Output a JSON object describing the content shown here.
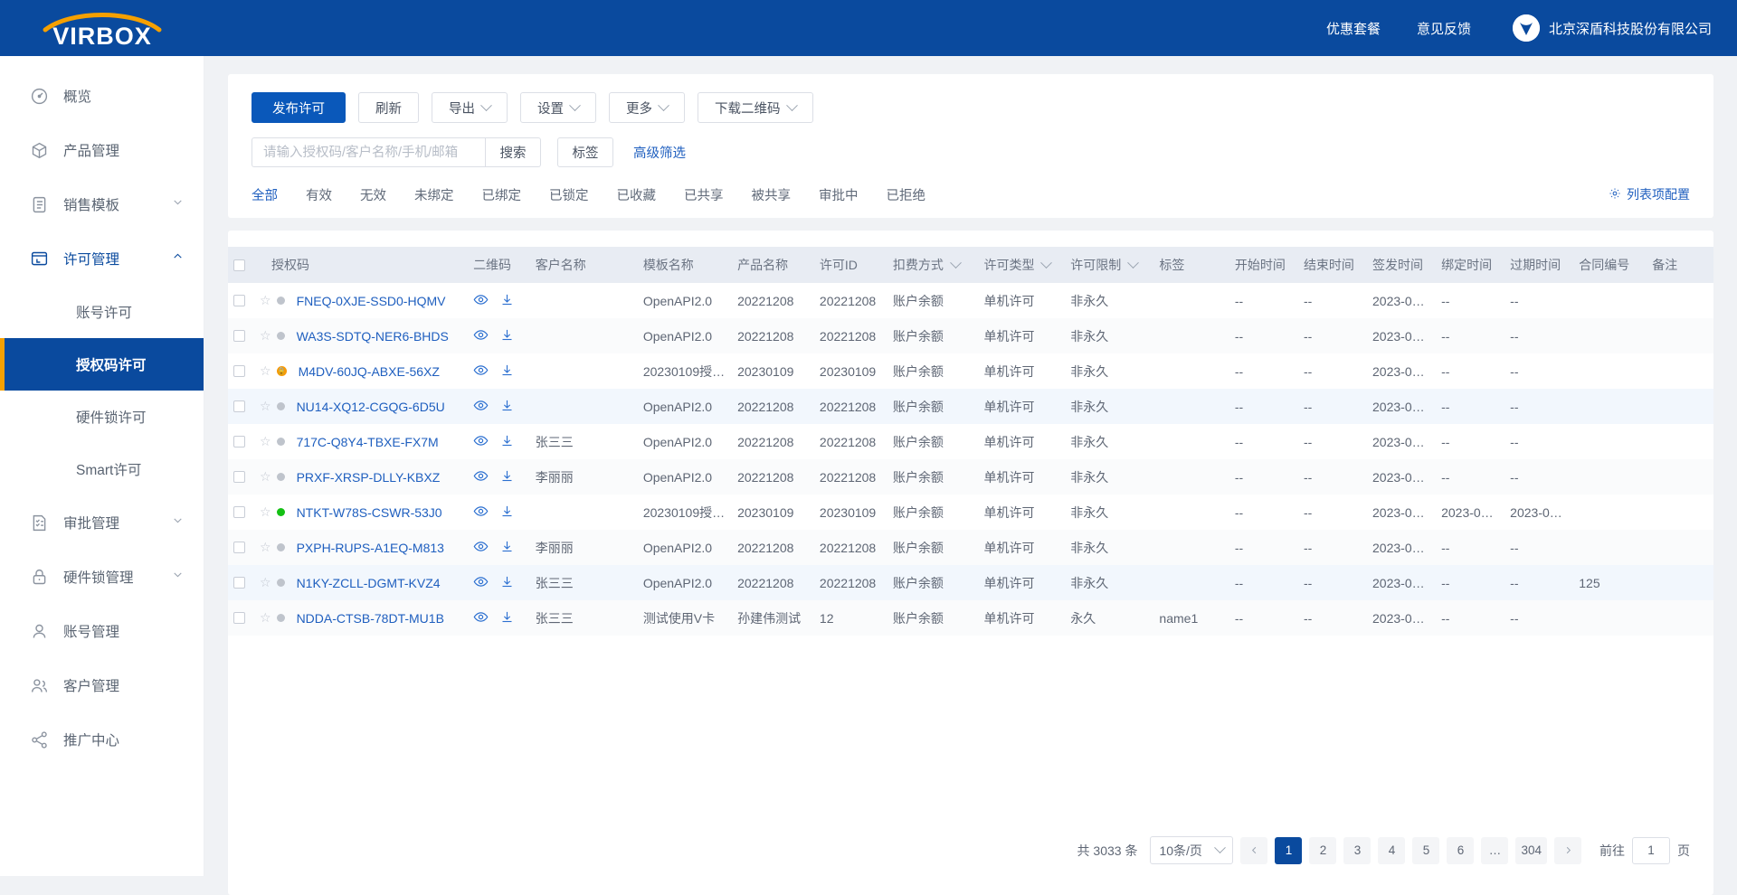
{
  "header": {
    "logo_text": "VIRBOX",
    "links": [
      {
        "label": "优惠套餐",
        "name": "promo-packages-link"
      },
      {
        "label": "意见反馈",
        "name": "feedback-link"
      }
    ],
    "company": "北京深盾科技股份有限公司",
    "brand_blue": "#0a4a9e",
    "brand_orange": "#f5a000"
  },
  "sidebar": {
    "items": [
      {
        "label": "概览",
        "icon": "dashboard-icon",
        "type": "item"
      },
      {
        "label": "产品管理",
        "icon": "cube-icon",
        "type": "item"
      },
      {
        "label": "销售模板",
        "icon": "clipboard-icon",
        "type": "group",
        "expanded": false
      },
      {
        "label": "许可管理",
        "icon": "license-icon",
        "type": "group",
        "expanded": true,
        "active": true
      },
      {
        "label": "账号许可",
        "type": "sub"
      },
      {
        "label": "授权码许可",
        "type": "sub",
        "selected": true
      },
      {
        "label": "硬件锁许可",
        "type": "sub"
      },
      {
        "label": "Smart许可",
        "type": "sub"
      },
      {
        "label": "审批管理",
        "icon": "approval-icon",
        "type": "group",
        "expanded": false
      },
      {
        "label": "硬件锁管理",
        "icon": "lock-icon",
        "type": "group",
        "expanded": false
      },
      {
        "label": "账号管理",
        "icon": "user-icon",
        "type": "item"
      },
      {
        "label": "客户管理",
        "icon": "users-icon",
        "type": "item"
      },
      {
        "label": "推广中心",
        "icon": "share-icon",
        "type": "item"
      }
    ]
  },
  "toolbar": {
    "publish_label": "发布许可",
    "refresh_label": "刷新",
    "export_label": "导出",
    "settings_label": "设置",
    "more_label": "更多",
    "download_qr_label": "下载二维码"
  },
  "search": {
    "placeholder": "请输入授权码/客户名称/手机/邮箱",
    "value": "",
    "search_label": "搜索",
    "tag_label": "标签",
    "advanced_label": "高级筛选"
  },
  "tabs": [
    {
      "label": "全部",
      "active": true
    },
    {
      "label": "有效",
      "active": false
    },
    {
      "label": "无效",
      "active": false
    },
    {
      "label": "未绑定",
      "active": false
    },
    {
      "label": "已绑定",
      "active": false
    },
    {
      "label": "已锁定",
      "active": false
    },
    {
      "label": "已收藏",
      "active": false
    },
    {
      "label": "已共享",
      "active": false
    },
    {
      "label": "被共享",
      "active": false
    },
    {
      "label": "审批中",
      "active": false
    },
    {
      "label": "已拒绝",
      "active": false
    }
  ],
  "list_config_label": "列表项配置",
  "table": {
    "columns": [
      {
        "key": "code",
        "label": "授权码",
        "sortable": false
      },
      {
        "key": "qr",
        "label": "二维码",
        "sortable": false
      },
      {
        "key": "customer",
        "label": "客户名称",
        "sortable": false
      },
      {
        "key": "template",
        "label": "模板名称",
        "sortable": false
      },
      {
        "key": "product",
        "label": "产品名称",
        "sortable": false
      },
      {
        "key": "license_id",
        "label": "许可ID",
        "sortable": false
      },
      {
        "key": "billing",
        "label": "扣费方式",
        "sortable": true
      },
      {
        "key": "lic_type",
        "label": "许可类型",
        "sortable": true
      },
      {
        "key": "lic_limit",
        "label": "许可限制",
        "sortable": true
      },
      {
        "key": "tag",
        "label": "标签",
        "sortable": false
      },
      {
        "key": "start_time",
        "label": "开始时间",
        "sortable": false
      },
      {
        "key": "end_time",
        "label": "结束时间",
        "sortable": false
      },
      {
        "key": "issue_time",
        "label": "签发时间",
        "sortable": false
      },
      {
        "key": "bind_time",
        "label": "绑定时间",
        "sortable": false
      },
      {
        "key": "expire_time",
        "label": "过期时间",
        "sortable": false
      },
      {
        "key": "contract_no",
        "label": "合同编号",
        "sortable": false
      },
      {
        "key": "remark",
        "label": "备注",
        "sortable": false
      }
    ],
    "rows": [
      {
        "code": "FNEQ-0XJE-SSD0-HQMV",
        "status": "grey",
        "locked": false,
        "customer": "",
        "template": "OpenAPI2.0",
        "product": "20221208",
        "license_id": "20221208",
        "billing": "账户余额",
        "lic_type": "单机许可",
        "lic_limit": "非永久",
        "tag": "",
        "start_time": "--",
        "end_time": "--",
        "issue_time": "2023-0…",
        "bind_time": "--",
        "expire_time": "--",
        "contract_no": "",
        "remark": ""
      },
      {
        "code": "WA3S-SDTQ-NER6-BHDS",
        "status": "grey",
        "locked": false,
        "customer": "",
        "template": "OpenAPI2.0",
        "product": "20221208",
        "license_id": "20221208",
        "billing": "账户余额",
        "lic_type": "单机许可",
        "lic_limit": "非永久",
        "tag": "",
        "start_time": "--",
        "end_time": "--",
        "issue_time": "2023-0…",
        "bind_time": "--",
        "expire_time": "--",
        "contract_no": "",
        "remark": ""
      },
      {
        "code": "M4DV-60JQ-ABXE-56XZ",
        "status": "none",
        "locked": true,
        "customer": "",
        "template": "20230109授…",
        "product": "20230109",
        "license_id": "20230109",
        "billing": "账户余额",
        "lic_type": "单机许可",
        "lic_limit": "非永久",
        "tag": "",
        "start_time": "--",
        "end_time": "--",
        "issue_time": "2023-0…",
        "bind_time": "--",
        "expire_time": "--",
        "contract_no": "",
        "remark": ""
      },
      {
        "code": "NU14-XQ12-CGQG-6D5U",
        "status": "grey",
        "locked": false,
        "customer": "",
        "template": "OpenAPI2.0",
        "product": "20221208",
        "license_id": "20221208",
        "billing": "账户余额",
        "lic_type": "单机许可",
        "lic_limit": "非永久",
        "tag": "",
        "start_time": "--",
        "end_time": "--",
        "issue_time": "2023-0…",
        "bind_time": "--",
        "expire_time": "--",
        "contract_no": "",
        "remark": ""
      },
      {
        "code": "717C-Q8Y4-TBXE-FX7M",
        "status": "grey",
        "locked": false,
        "customer": "张三三",
        "template": "OpenAPI2.0",
        "product": "20221208",
        "license_id": "20221208",
        "billing": "账户余额",
        "lic_type": "单机许可",
        "lic_limit": "非永久",
        "tag": "",
        "start_time": "--",
        "end_time": "--",
        "issue_time": "2023-0…",
        "bind_time": "--",
        "expire_time": "--",
        "contract_no": "",
        "remark": ""
      },
      {
        "code": "PRXF-XRSP-DLLY-KBXZ",
        "status": "grey",
        "locked": false,
        "customer": "李丽丽",
        "template": "OpenAPI2.0",
        "product": "20221208",
        "license_id": "20221208",
        "billing": "账户余额",
        "lic_type": "单机许可",
        "lic_limit": "非永久",
        "tag": "",
        "start_time": "--",
        "end_time": "--",
        "issue_time": "2023-0…",
        "bind_time": "--",
        "expire_time": "--",
        "contract_no": "",
        "remark": ""
      },
      {
        "code": "NTKT-W78S-CSWR-53J0",
        "status": "green",
        "locked": false,
        "customer": "",
        "template": "20230109授…",
        "product": "20230109",
        "license_id": "20230109",
        "billing": "账户余额",
        "lic_type": "单机许可",
        "lic_limit": "非永久",
        "tag": "",
        "start_time": "--",
        "end_time": "--",
        "issue_time": "2023-0…",
        "bind_time": "2023-0…",
        "expire_time": "2023-0…",
        "contract_no": "",
        "remark": ""
      },
      {
        "code": "PXPH-RUPS-A1EQ-M813",
        "status": "grey",
        "locked": false,
        "customer": "李丽丽",
        "template": "OpenAPI2.0",
        "product": "20221208",
        "license_id": "20221208",
        "billing": "账户余额",
        "lic_type": "单机许可",
        "lic_limit": "非永久",
        "tag": "",
        "start_time": "--",
        "end_time": "--",
        "issue_time": "2023-0…",
        "bind_time": "--",
        "expire_time": "--",
        "contract_no": "",
        "remark": ""
      },
      {
        "code": "N1KY-ZCLL-DGMT-KVZ4",
        "status": "grey",
        "locked": false,
        "customer": "张三三",
        "template": "OpenAPI2.0",
        "product": "20221208",
        "license_id": "20221208",
        "billing": "账户余额",
        "lic_type": "单机许可",
        "lic_limit": "非永久",
        "tag": "",
        "start_time": "--",
        "end_time": "--",
        "issue_time": "2023-0…",
        "bind_time": "--",
        "expire_time": "--",
        "contract_no": "125",
        "remark": ""
      },
      {
        "code": "NDDA-CTSB-78DT-MU1B",
        "status": "grey",
        "locked": false,
        "customer": "张三三",
        "template": "测试使用V卡",
        "product": "孙建伟测试",
        "license_id": "12",
        "billing": "账户余额",
        "lic_type": "单机许可",
        "lic_limit": "永久",
        "tag": "name1",
        "start_time": "--",
        "end_time": "--",
        "issue_time": "2023-0…",
        "bind_time": "--",
        "expire_time": "--",
        "contract_no": "",
        "remark": ""
      }
    ]
  },
  "pagination": {
    "total_text": "共 3033 条",
    "page_size_label": "10条/页",
    "pages": [
      "1",
      "2",
      "3",
      "4",
      "5",
      "6",
      "…",
      "304"
    ],
    "current": "1",
    "prev_icon": "chevron-left-icon",
    "next_icon": "chevron-right-icon",
    "goto_label": "前往",
    "goto_value": "1",
    "page_unit": "页"
  }
}
